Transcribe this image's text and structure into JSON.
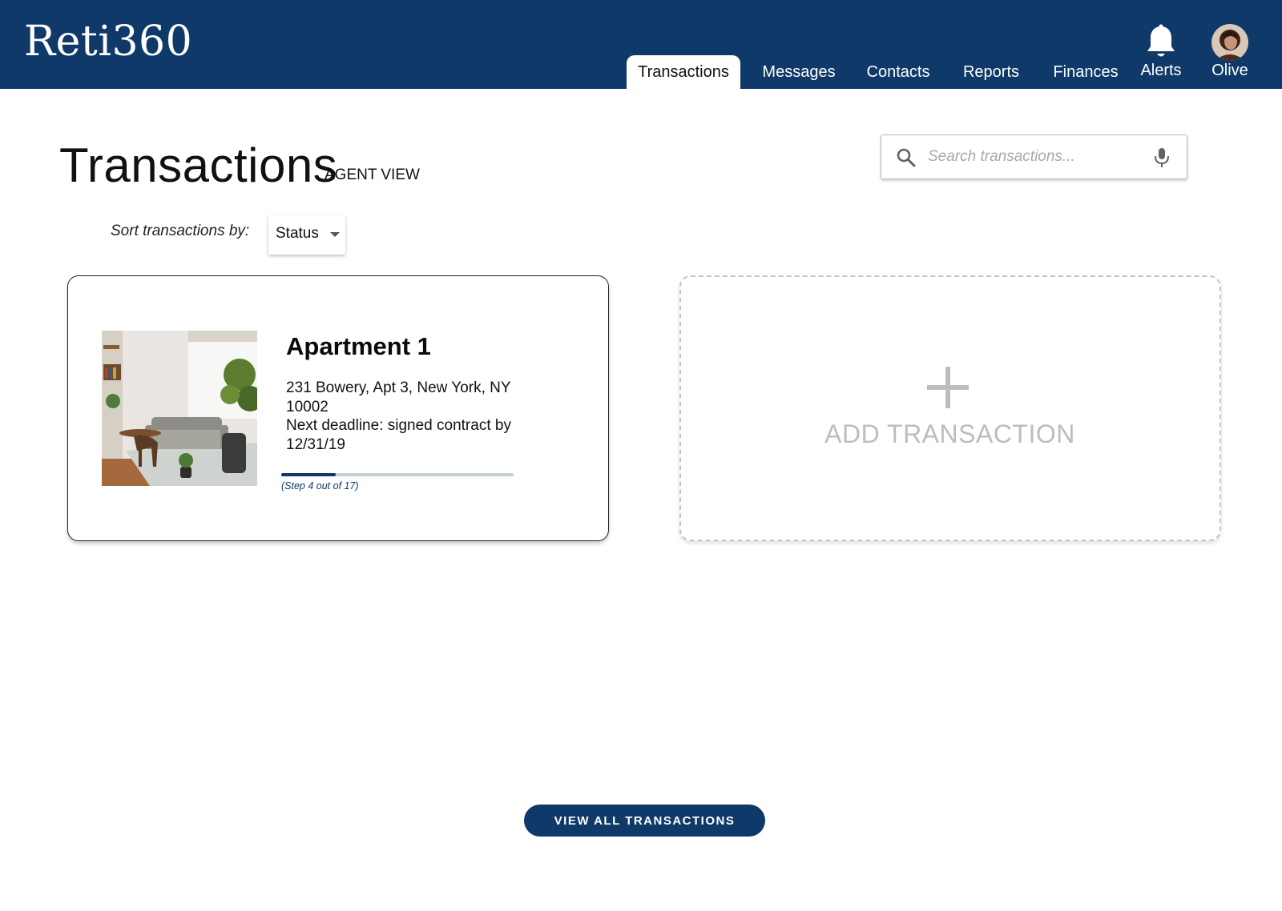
{
  "app": {
    "logo": "Reti360"
  },
  "nav": {
    "tabs": [
      {
        "label": "Transactions",
        "active": true
      },
      {
        "label": "Messages",
        "active": false
      },
      {
        "label": "Contacts",
        "active": false
      },
      {
        "label": "Reports",
        "active": false
      },
      {
        "label": "Finances",
        "active": false
      }
    ],
    "alerts_label": "Alerts",
    "user_name": "Olive"
  },
  "page": {
    "title": "Transactions",
    "view_label": "AGENT VIEW"
  },
  "search": {
    "placeholder": "Search transactions...",
    "value": ""
  },
  "sort": {
    "label": "Sort transactions by:",
    "selected": "Status"
  },
  "transactions": [
    {
      "title": "Apartment 1",
      "address": "231 Bowery, Apt 3, New York, NY 10002",
      "deadline": "Next deadline: signed contract by 12/31/19",
      "step_label": "(Step 4 out of 17)",
      "step": 4,
      "total_steps": 17
    }
  ],
  "add_card": {
    "label": "ADD TRANSACTION"
  },
  "footer": {
    "view_all_label": "VIEW ALL TRANSACTIONS"
  },
  "colors": {
    "brand_navy": "#0f3969",
    "progress_track": "#c5d0d6",
    "placeholder_gray": "#bdbdbd"
  },
  "icons": {
    "bell": "bell-icon",
    "avatar": "user-avatar",
    "search": "search-icon",
    "mic": "microphone-icon",
    "caret": "caret-down-icon",
    "plus": "plus-icon"
  }
}
